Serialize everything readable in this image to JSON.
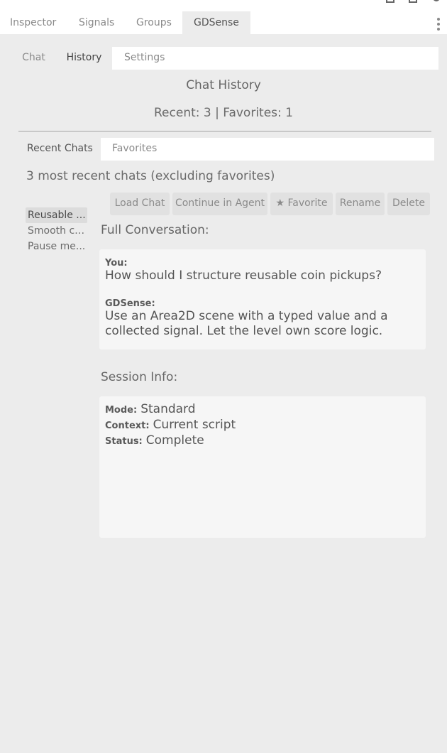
{
  "dock": {
    "tabs": [
      {
        "label": "Inspector",
        "active": false
      },
      {
        "label": "Signals",
        "active": false
      },
      {
        "label": "Groups",
        "active": false
      },
      {
        "label": "GDSense",
        "active": true
      }
    ]
  },
  "plugin_tabs": [
    {
      "label": "Chat",
      "active": false
    },
    {
      "label": "History",
      "active": true
    },
    {
      "label": "Settings",
      "active": false
    }
  ],
  "page": {
    "title": "Chat History",
    "counts": "Recent: 3 | Favorites: 1"
  },
  "history_tabs": [
    {
      "label": "Recent Chats",
      "active": true
    },
    {
      "label": "Favorites",
      "active": false
    }
  ],
  "recent": {
    "subtitle": "3 most recent chats (excluding favorites)",
    "items": [
      {
        "label": "Reusable ...",
        "selected": true
      },
      {
        "label": "Smooth ca...",
        "selected": false
      },
      {
        "label": "Pause me...",
        "selected": false
      }
    ]
  },
  "actions": {
    "load": "Load Chat",
    "continue": "Continue in Agent",
    "favorite": "★ Favorite",
    "rename": "Rename",
    "delete": "Delete"
  },
  "conversation": {
    "heading": "Full Conversation:",
    "user_label": "You:",
    "user_msg": "How should I structure reusable coin pickups?",
    "bot_label": "GDSense:",
    "bot_msg": "Use an Area2D scene with a typed value and a collected signal. Let the level own score logic."
  },
  "session": {
    "heading": "Session Info:",
    "mode_label": "Mode:",
    "mode": "Standard",
    "context_label": "Context:",
    "context": "Current script",
    "status_label": "Status:",
    "status": "Complete"
  },
  "colors": {
    "background": "#ececec",
    "tab_strip": "#ffffff",
    "button": "#e1e1e1",
    "panel": "#f6f6f6",
    "selected_item": "#dcdcdc"
  }
}
